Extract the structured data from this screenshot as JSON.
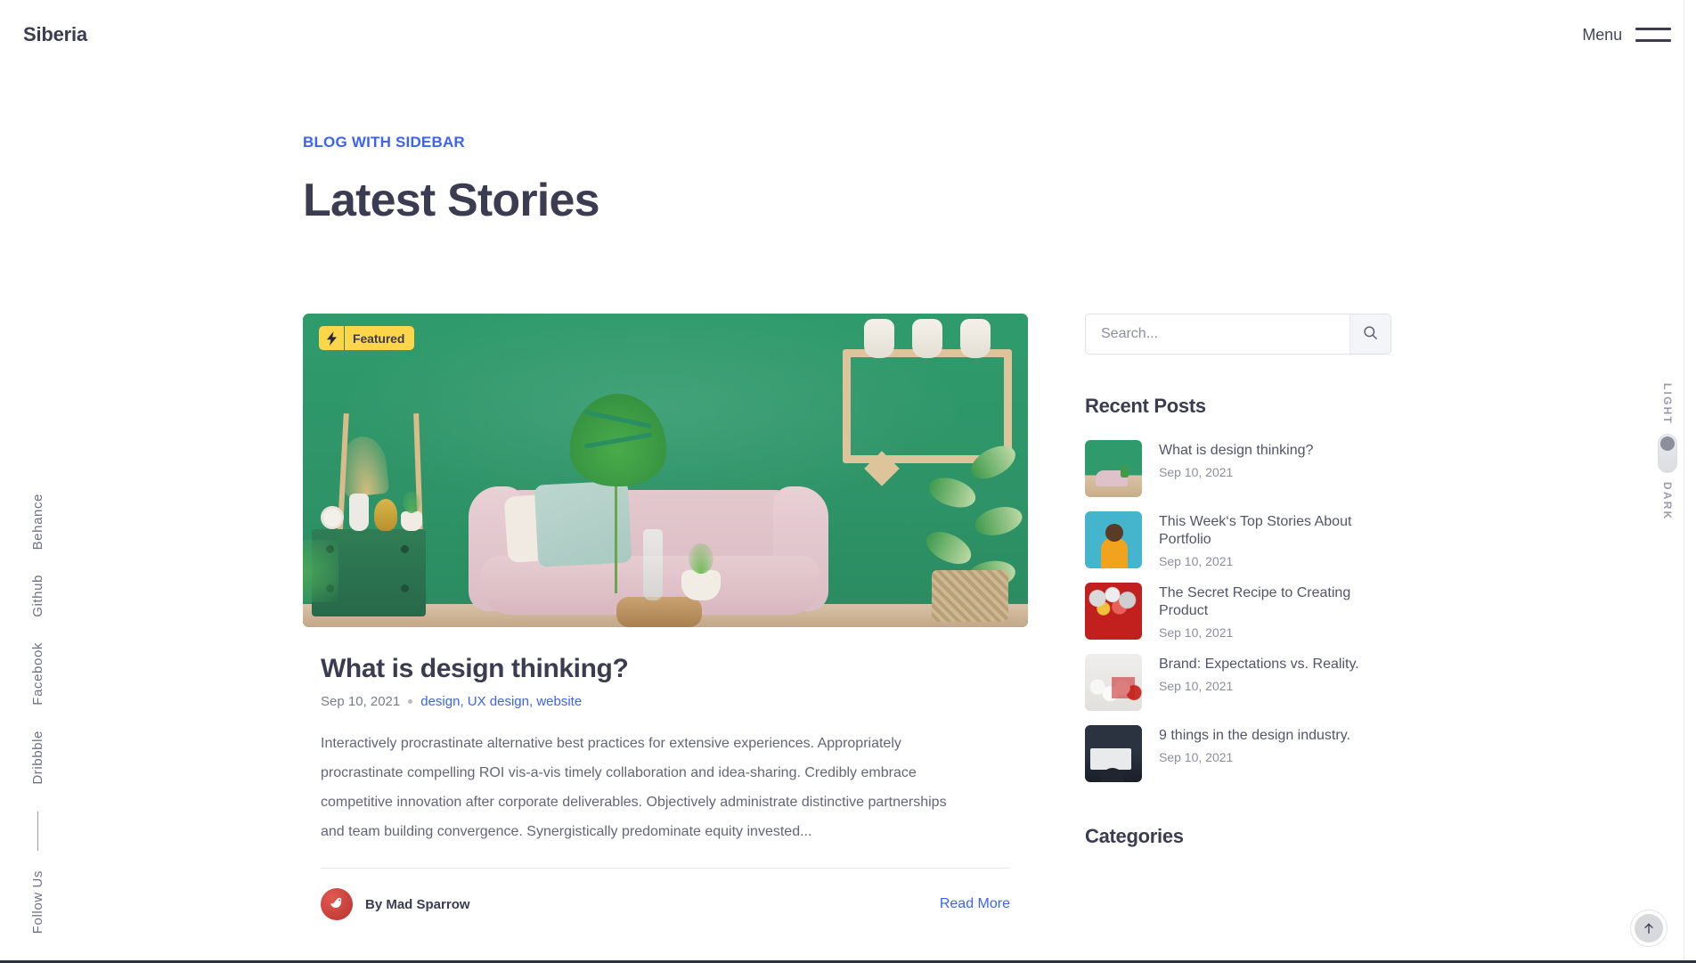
{
  "header": {
    "brand": "Siberia",
    "menu_label": "Menu",
    "menu_icon": "hamburger-icon"
  },
  "social_rail": {
    "follow_label": "Follow Us",
    "items": [
      "Dribbble",
      "Facebook",
      "Github",
      "Behance"
    ]
  },
  "page_head": {
    "eyebrow": "BLOG WITH SIDEBAR",
    "title": "Latest Stories"
  },
  "article": {
    "badge": {
      "icon": "lightning-bolt-icon",
      "label": "Featured"
    },
    "title": "What is design thinking?",
    "date": "Sep 10, 2021",
    "tags": "design, UX design, website",
    "excerpt": "Interactively procrastinate alternative best practices for extensive experiences. Appropriately procrastinate compelling ROI vis-a-vis timely collaboration and idea-sharing. Credibly embrace competitive innovation after corporate deliverables. Objectively administrate distinctive partnerships and team building convergence. Synergistically predominate equity invested...",
    "author": "By Mad Sparrow",
    "author_avatar_icon": "bird-avatar-icon",
    "read_more": "Read More"
  },
  "sidebar": {
    "search": {
      "placeholder": "Search...",
      "value": "",
      "button_icon": "search-icon"
    },
    "recent_posts_heading": "Recent Posts",
    "recent_posts": [
      {
        "title": "What is design thinking?",
        "date": "Sep 10, 2021",
        "thumb": "t-room"
      },
      {
        "title": "This Week‘s Top Stories About Portfolio",
        "date": "Sep 10, 2021",
        "thumb": "t-yellow"
      },
      {
        "title": "The Secret Recipe to Creating Product",
        "date": "Sep 10, 2021",
        "thumb": "t-red"
      },
      {
        "title": "Brand: Expectations vs. Reality.",
        "date": "Sep 10, 2021",
        "thumb": "t-keys"
      },
      {
        "title": "9 things in the design industry.",
        "date": "Sep 10, 2021",
        "thumb": "t-desk"
      }
    ],
    "categories_heading": "Categories"
  },
  "theme_toggle": {
    "light_label": "LIGHT",
    "dark_label": "DARK",
    "state": "light"
  },
  "scroll_top": {
    "icon": "arrow-up-icon"
  },
  "colors": {
    "accent_blue": "#3b63f6",
    "badge_yellow": "#ffd54a",
    "heading": "#3b3c52",
    "body_text": "#63657a",
    "muted": "#8c8e9d"
  }
}
